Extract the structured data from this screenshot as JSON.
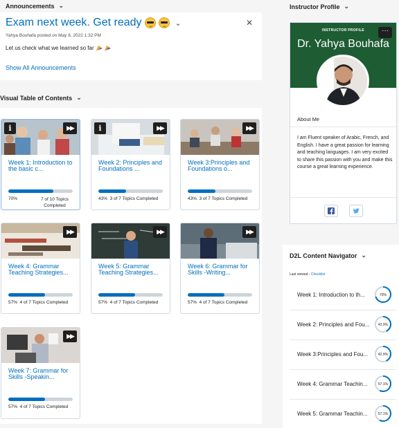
{
  "announcements": {
    "header": "Announcements",
    "title": "Exam next week. Get ready",
    "meta": "Yahya Bouhafa posted on May 8, 2022 1:32 PM",
    "body": "Let us check what we learned so far",
    "show_all": "Show All Announcements",
    "close_icon": "close-icon"
  },
  "toc": {
    "header": "Visual Table of Contents",
    "cards": [
      {
        "title": "Week 1: Introduction to the basic c...",
        "progress": 70,
        "percent_label": "70%",
        "status": "7 of 10 Topics Completed",
        "info_badge": true,
        "active": true
      },
      {
        "title": "Week 2: Principles and Foundations ...",
        "progress": 43,
        "percent_label": "43%",
        "status": "3 of 7 Topics Completed",
        "info_badge": true,
        "active": false
      },
      {
        "title": "Week 3:Principles and Foundations o...",
        "progress": 43,
        "percent_label": "43%",
        "status": "3 of 7 Topics Completed",
        "info_badge": false,
        "active": false
      },
      {
        "title": "Week 4: Grammar Teaching Strategies...",
        "progress": 57,
        "percent_label": "57%",
        "status": "4 of 7 Topics Completed",
        "info_badge": false,
        "active": false
      },
      {
        "title": "Week 5: Grammar Teaching Strategies...",
        "progress": 57,
        "percent_label": "57%",
        "status": "4 of 7 Topics Completed",
        "info_badge": false,
        "active": false
      },
      {
        "title": "Week 6: Grammar for Skills -Writing...",
        "progress": 57,
        "percent_label": "57%",
        "status": "4 of 7 Topics Completed",
        "info_badge": false,
        "active": false
      },
      {
        "title": "Week 7: Grammar for Skills -Speakin...",
        "progress": 57,
        "percent_label": "57%",
        "status": "4 of 7 Topics Completed",
        "info_badge": false,
        "active": false
      }
    ]
  },
  "instructor": {
    "header": "Instructor Profile",
    "label": "INSTRUCTOR PROFILE",
    "name": "Dr. Yahya Bouhafa",
    "about_heading": "About Me",
    "about": "I am Fluent speaker of Arabic, French, and English. I have a great passion for learning and teaching languages. I am very excited to share this passion with you and make this course a great learning experience.",
    "banner_color": "#1e5c34",
    "more_icon": "more-icon",
    "social": [
      "facebook-icon",
      "twitter-icon"
    ]
  },
  "navigator": {
    "header": "D2L Content Navigator",
    "last_viewed_label": "Last viewed -",
    "last_viewed_link": "Checklist",
    "items": [
      {
        "label": "Week 1: Introduction to th...",
        "progress": 70,
        "progress_label": "70%"
      },
      {
        "label": "Week 2: Principles and Fou...",
        "progress": 42.9,
        "progress_label": "42.9%"
      },
      {
        "label": "Week 3:Principles and Fou...",
        "progress": 42.9,
        "progress_label": "42.9%"
      },
      {
        "label": "Week 4: Grammar Teachin...",
        "progress": 57.1,
        "progress_label": "57.1%"
      },
      {
        "label": "Week 5: Grammar Teachin...",
        "progress": 57.1,
        "progress_label": "57.1%"
      }
    ]
  },
  "colors": {
    "accent": "#006fbf",
    "track": "#cdd5dc"
  }
}
